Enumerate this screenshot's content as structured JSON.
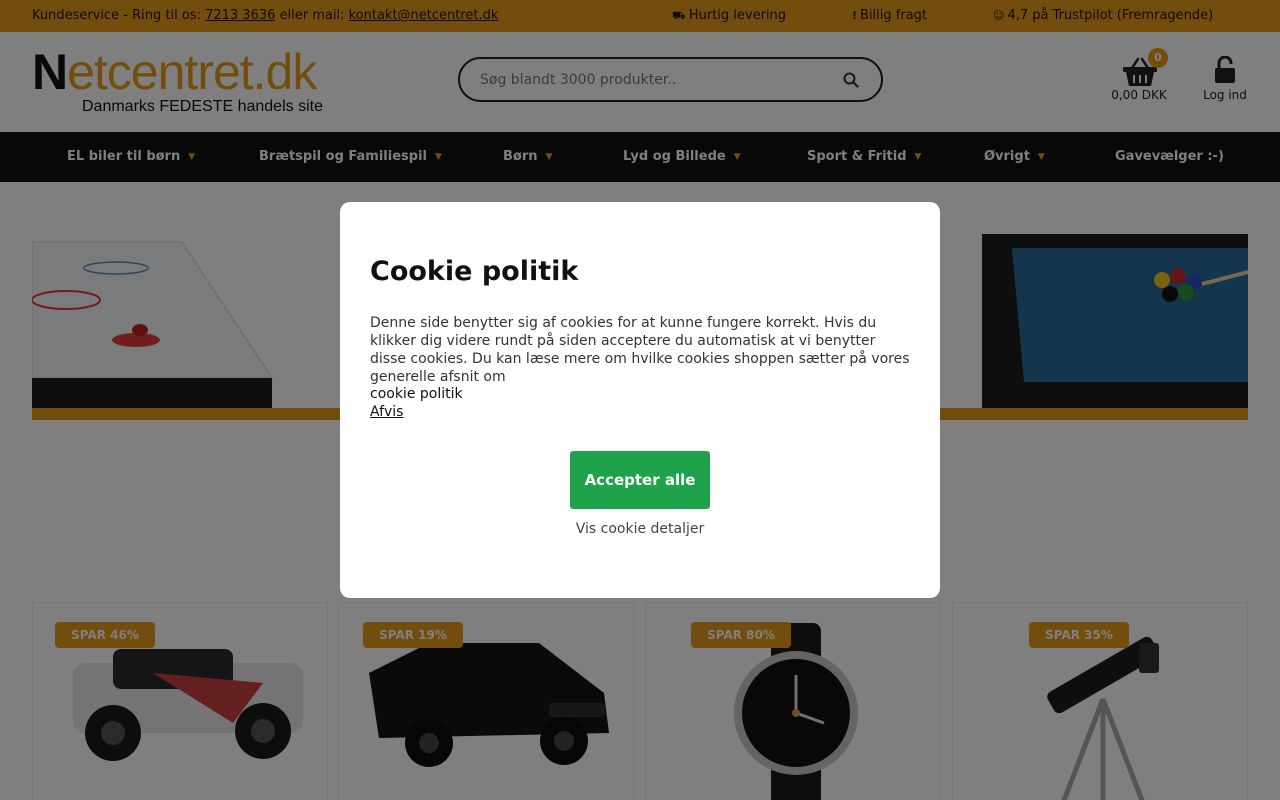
{
  "topbar": {
    "service_prefix": "Kundeservice - Ring til os: ",
    "phone": "7213 3636",
    "mail_prefix": " eller mail: ",
    "email": "kontakt@netcentret.dk",
    "usps": [
      {
        "icon": "truck-icon",
        "glyph": "⛟",
        "text": "Hurtig levering"
      },
      {
        "icon": "exclamation-icon",
        "glyph": "!",
        "text": "Billig fragt"
      },
      {
        "icon": "user-circle-icon",
        "glyph": "☺",
        "text": "4,7 på Trustpilot (Fremragende)"
      }
    ]
  },
  "header": {
    "logo_main_first": "N",
    "logo_main_rest": "etcentret.dk",
    "logo_sub": "Danmarks FEDESTE handels site",
    "search_placeholder": "Søg blandt 3000 produkter..",
    "cart_count": "0",
    "cart_amount": "0,00 DKK",
    "login_label": "Log ind"
  },
  "nav": {
    "items": [
      {
        "label": "EL biler til børn",
        "dropdown": true
      },
      {
        "label": "Brætspil og Familiespil",
        "dropdown": true
      },
      {
        "label": "Børn",
        "dropdown": true
      },
      {
        "label": "Lyd og Billede",
        "dropdown": true
      },
      {
        "label": "Sport & Fritid",
        "dropdown": true
      },
      {
        "label": "Øvrigt",
        "dropdown": true
      },
      {
        "label": "Gavevælger :-)",
        "dropdown": false
      }
    ]
  },
  "products": [
    {
      "badge": "SPAR 46%",
      "image": "rc-truck"
    },
    {
      "badge": "SPAR 19%",
      "image": "kids-electric-car"
    },
    {
      "badge": "SPAR 80%",
      "image": "wristwatch"
    },
    {
      "badge": "SPAR 35%",
      "image": "telescope"
    }
  ],
  "cookie_modal": {
    "title": "Cookie politik",
    "body": "Denne side benytter sig af cookies for at kunne fungere korrekt. Hvis du klikker dig videre rundt på siden acceptere du automatisk at vi benytter disse cookies. Du kan læse mere om hvilke cookies shoppen sætter på vores generelle afsnit om",
    "policy_link": "cookie politik",
    "reject_link": "Afvis",
    "accept_button": "Accepter alle",
    "details_link": "Vis cookie detaljer"
  },
  "colors": {
    "accent": "#e69b1a",
    "nav_bg": "#111111",
    "accept_green": "#1ea24b"
  }
}
